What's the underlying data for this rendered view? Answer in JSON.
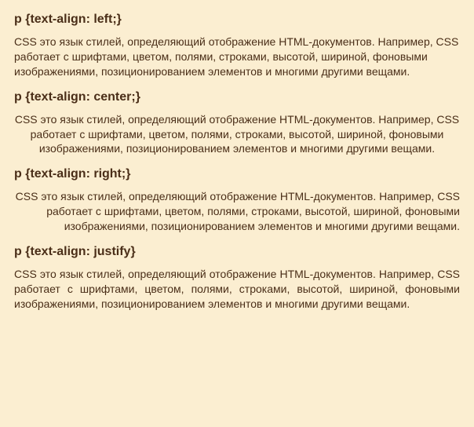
{
  "sections": [
    {
      "code": "p {text-align: left;}",
      "align": "left",
      "body": "CSS это язык стилей, определяющий отображение HTML-документов. Например, CSS работает с шрифтами, цветом, полями, строками, высотой, шириной, фоновыми изображениями, позиционированием элементов и многими другими вещами."
    },
    {
      "code": "p {text-align: center;}",
      "align": "center",
      "body": "CSS это язык стилей, определяющий отображение HTML-документов. Например, CSS работает с шрифтами, цветом, полями, строками, высотой, шириной, фоновыми изображениями, позиционированием элементов и многими другими вещами."
    },
    {
      "code": "p {text-align: right;}",
      "align": "right",
      "body": "CSS это язык стилей, определяющий отображение HTML-документов. Например, CSS работает с шрифтами, цветом, полями, строками, высотой, шириной, фоновыми изображениями, позиционированием элементов и многими другими вещами."
    },
    {
      "code": "p {text-align: justify}",
      "align": "justify",
      "body": "CSS это язык стилей, определяющий отображение HTML-документов. Например, CSS работает с шрифтами, цветом, полями, строками, высотой, шириной, фоновыми изображениями, позиционированием элементов и многими другими вещами."
    }
  ]
}
